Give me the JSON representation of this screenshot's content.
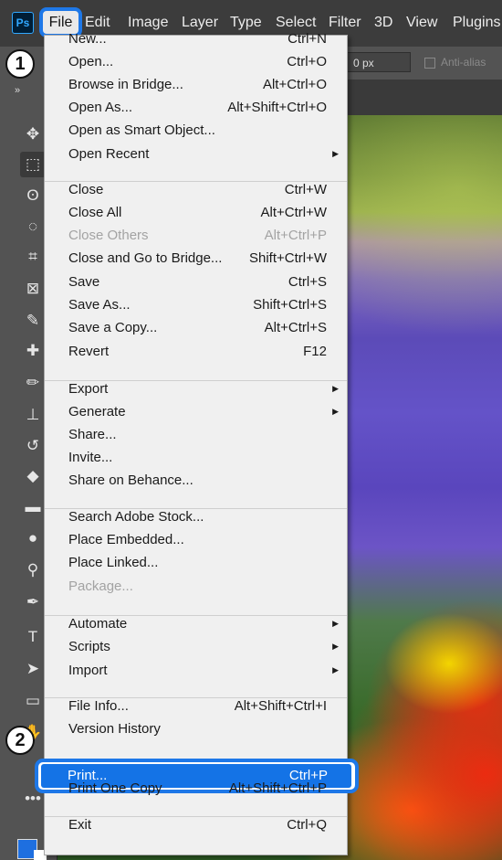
{
  "app": {
    "logo": "Ps"
  },
  "menubar": {
    "items": [
      {
        "label": "File"
      },
      {
        "label": "Edit"
      },
      {
        "label": "Image"
      },
      {
        "label": "Layer"
      },
      {
        "label": "Type"
      },
      {
        "label": "Select"
      },
      {
        "label": "Filter"
      },
      {
        "label": "3D"
      },
      {
        "label": "View"
      },
      {
        "label": "Plugins"
      }
    ]
  },
  "options": {
    "feather_value": "0 px",
    "antialias_label": "Anti-alias"
  },
  "steps": {
    "one": "1",
    "two": "2"
  },
  "file_menu": {
    "groups": [
      [
        {
          "label": "New...",
          "shortcut": "Ctrl+N"
        },
        {
          "label": "Open...",
          "shortcut": "Ctrl+O"
        },
        {
          "label": "Browse in Bridge...",
          "shortcut": "Alt+Ctrl+O"
        },
        {
          "label": "Open As...",
          "shortcut": "Alt+Shift+Ctrl+O"
        },
        {
          "label": "Open as Smart Object...",
          "shortcut": ""
        },
        {
          "label": "Open Recent",
          "shortcut": "",
          "submenu": true
        }
      ],
      [
        {
          "label": "Close",
          "shortcut": "Ctrl+W"
        },
        {
          "label": "Close All",
          "shortcut": "Alt+Ctrl+W"
        },
        {
          "label": "Close Others",
          "shortcut": "Alt+Ctrl+P",
          "disabled": true
        },
        {
          "label": "Close and Go to Bridge...",
          "shortcut": "Shift+Ctrl+W"
        },
        {
          "label": "Save",
          "shortcut": "Ctrl+S"
        },
        {
          "label": "Save As...",
          "shortcut": "Shift+Ctrl+S"
        },
        {
          "label": "Save a Copy...",
          "shortcut": "Alt+Ctrl+S"
        },
        {
          "label": "Revert",
          "shortcut": "F12"
        }
      ],
      [
        {
          "label": "Export",
          "shortcut": "",
          "submenu": true
        },
        {
          "label": "Generate",
          "shortcut": "",
          "submenu": true
        },
        {
          "label": "Share...",
          "shortcut": ""
        },
        {
          "label": "Invite...",
          "shortcut": ""
        },
        {
          "label": "Share on Behance...",
          "shortcut": ""
        }
      ],
      [
        {
          "label": "Search Adobe Stock...",
          "shortcut": ""
        },
        {
          "label": "Place Embedded...",
          "shortcut": ""
        },
        {
          "label": "Place Linked...",
          "shortcut": ""
        },
        {
          "label": "Package...",
          "shortcut": "",
          "disabled": true
        }
      ],
      [
        {
          "label": "Automate",
          "shortcut": "",
          "submenu": true
        },
        {
          "label": "Scripts",
          "shortcut": "",
          "submenu": true
        },
        {
          "label": "Import",
          "shortcut": "",
          "submenu": true
        }
      ],
      [
        {
          "label": "File Info...",
          "shortcut": "Alt+Shift+Ctrl+I"
        },
        {
          "label": "Version History",
          "shortcut": ""
        },
        {
          "label": "Print...",
          "shortcut": "Ctrl+P",
          "highlighted": true
        },
        {
          "label": "Print One Copy",
          "shortcut": "Alt+Shift+Ctrl+P"
        }
      ],
      [
        {
          "label": "Exit",
          "shortcut": "Ctrl+Q"
        }
      ]
    ]
  },
  "toolbar": {
    "tools": [
      {
        "name": "move-tool-icon",
        "glyph": "✥"
      },
      {
        "name": "marquee-tool-icon",
        "glyph": "⬚",
        "selected": true
      },
      {
        "name": "lasso-tool-icon",
        "glyph": "ʘ"
      },
      {
        "name": "quick-selection-tool-icon",
        "glyph": "◌"
      },
      {
        "name": "crop-tool-icon",
        "glyph": "⌗"
      },
      {
        "name": "frame-tool-icon",
        "glyph": "⊠"
      },
      {
        "name": "eyedropper-tool-icon",
        "glyph": "✎"
      },
      {
        "name": "healing-brush-tool-icon",
        "glyph": "✚"
      },
      {
        "name": "brush-tool-icon",
        "glyph": "✏"
      },
      {
        "name": "clone-stamp-tool-icon",
        "glyph": "⊥"
      },
      {
        "name": "history-brush-tool-icon",
        "glyph": "↺"
      },
      {
        "name": "eraser-tool-icon",
        "glyph": "◆"
      },
      {
        "name": "gradient-tool-icon",
        "glyph": "▬"
      },
      {
        "name": "blur-tool-icon",
        "glyph": "●"
      },
      {
        "name": "dodge-tool-icon",
        "glyph": "⚲"
      },
      {
        "name": "pen-tool-icon",
        "glyph": "✒"
      },
      {
        "name": "type-tool-icon",
        "glyph": "T"
      },
      {
        "name": "path-selection-tool-icon",
        "glyph": "➤"
      },
      {
        "name": "rectangle-tool-icon",
        "glyph": "▭"
      },
      {
        "name": "hand-tool-icon",
        "glyph": "✋"
      },
      {
        "name": "edit-toolbar-icon",
        "glyph": "•••"
      }
    ]
  }
}
